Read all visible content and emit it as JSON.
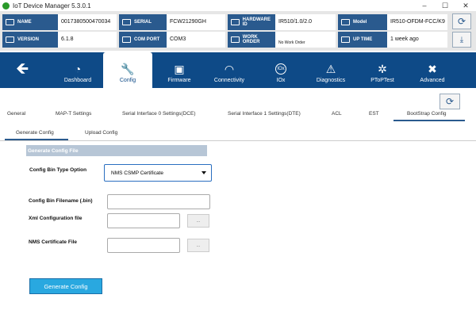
{
  "window": {
    "title": "IoT Device Manager 5.3.0.1",
    "min": "–",
    "max": "☐",
    "close": "✕"
  },
  "info": {
    "name_label": "NAME",
    "name_value": "0017380500470034",
    "serial_label": "SERIAL",
    "serial_value": "FCW21290GH",
    "hardware_label": "HARDWARE ID",
    "hardware_value": "IR510/1.0/2.0",
    "model_label": "Model",
    "model_value": "IR510-OFDM-FCC/K9",
    "version_label": "VERSION",
    "version_value": "6.1.8",
    "comport_label": "COM PORT",
    "comport_value": "COM3",
    "workorder_label": "WORK ORDER",
    "workorder_value": "No Work Order",
    "uptime_label": "UP TIME",
    "uptime_value": "1 week ago"
  },
  "nav": {
    "items": [
      {
        "label": "Dashboard",
        "icon": "gauge-icon"
      },
      {
        "label": "Config",
        "icon": "wrench-icon"
      },
      {
        "label": "Firmware",
        "icon": "chip-icon"
      },
      {
        "label": "Connectivity",
        "icon": "wifi-icon"
      },
      {
        "label": "IOx",
        "icon": "iox-icon"
      },
      {
        "label": "Diagnostics",
        "icon": "warning-icon"
      },
      {
        "label": "PToPTest",
        "icon": "network-icon"
      },
      {
        "label": "Advanced",
        "icon": "tools-icon"
      }
    ],
    "iox_glyph": "IOx"
  },
  "subtabs": [
    "General",
    "MAP-T Settings",
    "Serial Interface 0 Settings(DCE)",
    "Serial Interface 1 Settings(DTE)",
    "ACL",
    "EST",
    "BootStrap Config"
  ],
  "innertabs": [
    "Generate Config",
    "Upload Config"
  ],
  "form": {
    "section_title": "Generate Config File",
    "type_label": "Config Bin Type Option",
    "type_value": "NMS CSMP Certificate",
    "filename_label": "Config Bin Filename (.bin)",
    "xml_label": "Xml Configuration file",
    "nms_label": "NMS Certificate File",
    "browse_label": "...",
    "generate_label": "Generate Config"
  },
  "colors": {
    "accent": "#0e4a87",
    "label_bg": "#2a5a8e",
    "button": "#29a8e0"
  }
}
